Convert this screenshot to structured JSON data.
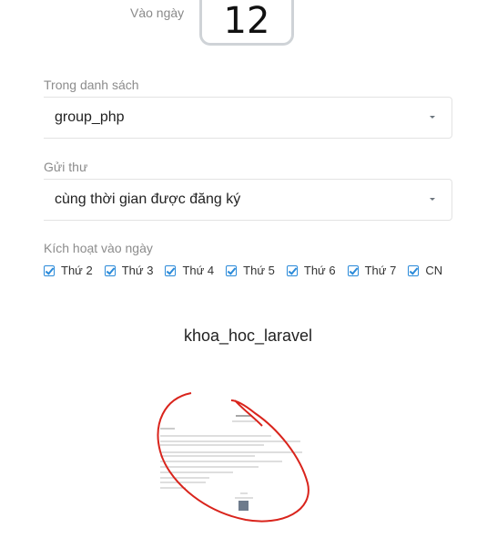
{
  "schedule": {
    "day_label": "Vào ngày",
    "day_value": "12"
  },
  "list_field": {
    "label": "Trong danh sách",
    "value": "group_php"
  },
  "send_field": {
    "label": "Gửi thư",
    "value": "cùng thời gian được đăng ký"
  },
  "active_days": {
    "label": "Kích hoạt vào ngày",
    "days": [
      {
        "label": "Thứ 2",
        "checked": true
      },
      {
        "label": "Thứ 3",
        "checked": true
      },
      {
        "label": "Thứ 4",
        "checked": true
      },
      {
        "label": "Thứ 5",
        "checked": true
      },
      {
        "label": "Thứ 6",
        "checked": true
      },
      {
        "label": "Thứ 7",
        "checked": true
      },
      {
        "label": "CN",
        "checked": true
      }
    ]
  },
  "course": {
    "title": "khoa_hoc_laravel"
  },
  "colors": {
    "checkbox_accent": "#2a8ad9",
    "annotation_red": "#d9241c"
  }
}
